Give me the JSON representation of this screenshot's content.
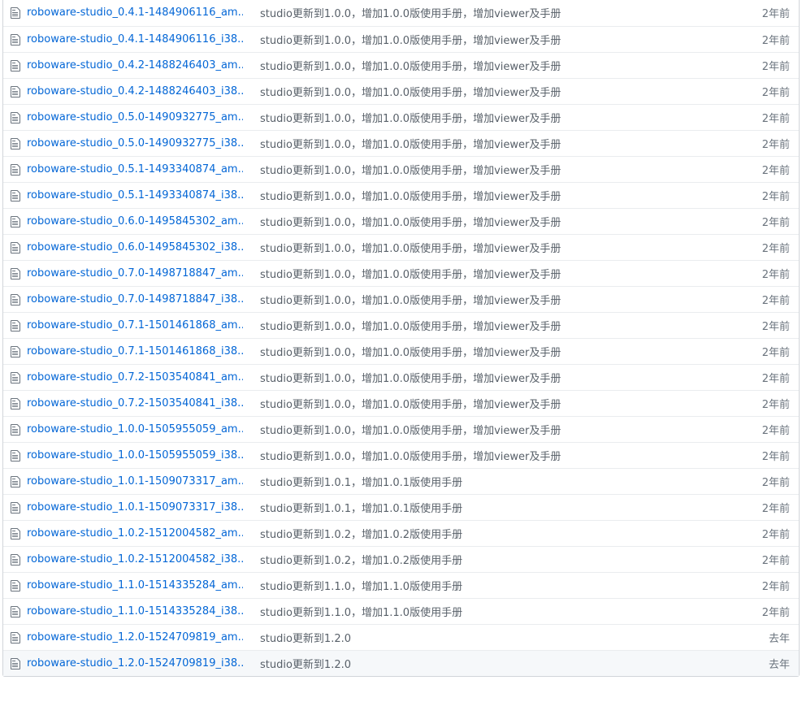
{
  "icons": {
    "file": "file-text-icon"
  },
  "colors": {
    "link": "#0366d6",
    "message": "#586069",
    "age": "#6a737d",
    "border": "#eaecef",
    "highlight": "#f6f8fa"
  },
  "files": [
    {
      "name": "roboware-studio_0.4.1-1484906116_am...",
      "message": "studio更新到1.0.0，增加1.0.0版使用手册，增加viewer及手册",
      "age": "2年前"
    },
    {
      "name": "roboware-studio_0.4.1-1484906116_i38...",
      "message": "studio更新到1.0.0，增加1.0.0版使用手册，增加viewer及手册",
      "age": "2年前"
    },
    {
      "name": "roboware-studio_0.4.2-1488246403_am...",
      "message": "studio更新到1.0.0，增加1.0.0版使用手册，增加viewer及手册",
      "age": "2年前"
    },
    {
      "name": "roboware-studio_0.4.2-1488246403_i38...",
      "message": "studio更新到1.0.0，增加1.0.0版使用手册，增加viewer及手册",
      "age": "2年前"
    },
    {
      "name": "roboware-studio_0.5.0-1490932775_am...",
      "message": "studio更新到1.0.0，增加1.0.0版使用手册，增加viewer及手册",
      "age": "2年前"
    },
    {
      "name": "roboware-studio_0.5.0-1490932775_i38...",
      "message": "studio更新到1.0.0，增加1.0.0版使用手册，增加viewer及手册",
      "age": "2年前"
    },
    {
      "name": "roboware-studio_0.5.1-1493340874_am...",
      "message": "studio更新到1.0.0，增加1.0.0版使用手册，增加viewer及手册",
      "age": "2年前"
    },
    {
      "name": "roboware-studio_0.5.1-1493340874_i38...",
      "message": "studio更新到1.0.0，增加1.0.0版使用手册，增加viewer及手册",
      "age": "2年前"
    },
    {
      "name": "roboware-studio_0.6.0-1495845302_am...",
      "message": "studio更新到1.0.0，增加1.0.0版使用手册，增加viewer及手册",
      "age": "2年前"
    },
    {
      "name": "roboware-studio_0.6.0-1495845302_i38...",
      "message": "studio更新到1.0.0，增加1.0.0版使用手册，增加viewer及手册",
      "age": "2年前"
    },
    {
      "name": "roboware-studio_0.7.0-1498718847_am...",
      "message": "studio更新到1.0.0，增加1.0.0版使用手册，增加viewer及手册",
      "age": "2年前"
    },
    {
      "name": "roboware-studio_0.7.0-1498718847_i38...",
      "message": "studio更新到1.0.0，增加1.0.0版使用手册，增加viewer及手册",
      "age": "2年前"
    },
    {
      "name": "roboware-studio_0.7.1-1501461868_am...",
      "message": "studio更新到1.0.0，增加1.0.0版使用手册，增加viewer及手册",
      "age": "2年前"
    },
    {
      "name": "roboware-studio_0.7.1-1501461868_i38...",
      "message": "studio更新到1.0.0，增加1.0.0版使用手册，增加viewer及手册",
      "age": "2年前"
    },
    {
      "name": "roboware-studio_0.7.2-1503540841_am...",
      "message": "studio更新到1.0.0，增加1.0.0版使用手册，增加viewer及手册",
      "age": "2年前"
    },
    {
      "name": "roboware-studio_0.7.2-1503540841_i38...",
      "message": "studio更新到1.0.0，增加1.0.0版使用手册，增加viewer及手册",
      "age": "2年前"
    },
    {
      "name": "roboware-studio_1.0.0-1505955059_am...",
      "message": "studio更新到1.0.0，增加1.0.0版使用手册，增加viewer及手册",
      "age": "2年前"
    },
    {
      "name": "roboware-studio_1.0.0-1505955059_i38...",
      "message": "studio更新到1.0.0，增加1.0.0版使用手册，增加viewer及手册",
      "age": "2年前"
    },
    {
      "name": "roboware-studio_1.0.1-1509073317_am...",
      "message": "studio更新到1.0.1，增加1.0.1版使用手册",
      "age": "2年前"
    },
    {
      "name": "roboware-studio_1.0.1-1509073317_i38...",
      "message": "studio更新到1.0.1，增加1.0.1版使用手册",
      "age": "2年前"
    },
    {
      "name": "roboware-studio_1.0.2-1512004582_am...",
      "message": "studio更新到1.0.2，增加1.0.2版使用手册",
      "age": "2年前"
    },
    {
      "name": "roboware-studio_1.0.2-1512004582_i38...",
      "message": "studio更新到1.0.2，增加1.0.2版使用手册",
      "age": "2年前"
    },
    {
      "name": "roboware-studio_1.1.0-1514335284_am...",
      "message": "studio更新到1.1.0，增加1.1.0版使用手册",
      "age": "2年前"
    },
    {
      "name": "roboware-studio_1.1.0-1514335284_i38...",
      "message": "studio更新到1.1.0，增加1.1.0版使用手册",
      "age": "2年前"
    },
    {
      "name": "roboware-studio_1.2.0-1524709819_am...",
      "message": "studio更新到1.2.0",
      "age": "去年"
    },
    {
      "name": "roboware-studio_1.2.0-1524709819_i38...",
      "message": "studio更新到1.2.0",
      "age": "去年",
      "highlight": true
    }
  ]
}
